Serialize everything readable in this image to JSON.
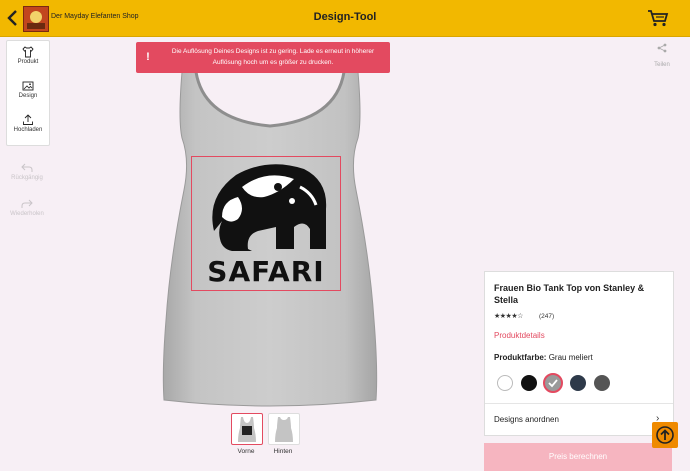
{
  "header": {
    "shop_name": "Der Mayday Elefanten Shop",
    "title": "Design-Tool"
  },
  "tools": {
    "product": "Produkt",
    "design": "Design",
    "upload": "Hochladen",
    "undo": "Rückgängig",
    "redo": "Wiederholen",
    "share": "Teilen"
  },
  "alert": {
    "icon": "!",
    "message": "Die Auflösung Deines Designs ist zu gering. Lade es erneut in höherer Auflösung hoch um es größer zu drucken."
  },
  "design": {
    "text": "SAFARI"
  },
  "views": {
    "front": "Vorne",
    "back": "Hinten"
  },
  "product": {
    "title": "Frauen Bio Tank Top von Stanley & Stella",
    "stars": "★★★★☆",
    "rating": 4.5,
    "review_count": "(247)",
    "details_link": "Produktdetails",
    "color_label": "Produktfarbe:",
    "color_value": "Grau meliert",
    "swatches": [
      "#ffffff",
      "#111111",
      "#9a9a9a",
      "#2e3a4a",
      "#555555"
    ],
    "selected_swatch": 2,
    "arrange_label": "Designs anordnen"
  },
  "actions": {
    "price_button": "Preis berechnen"
  },
  "colors": {
    "header_bg": "#f2b800",
    "alert_bg": "#e34a60",
    "accent": "#e34a60",
    "scroll_top_bg": "#ef8a00",
    "price_btn_bg": "#f6b5c0"
  }
}
